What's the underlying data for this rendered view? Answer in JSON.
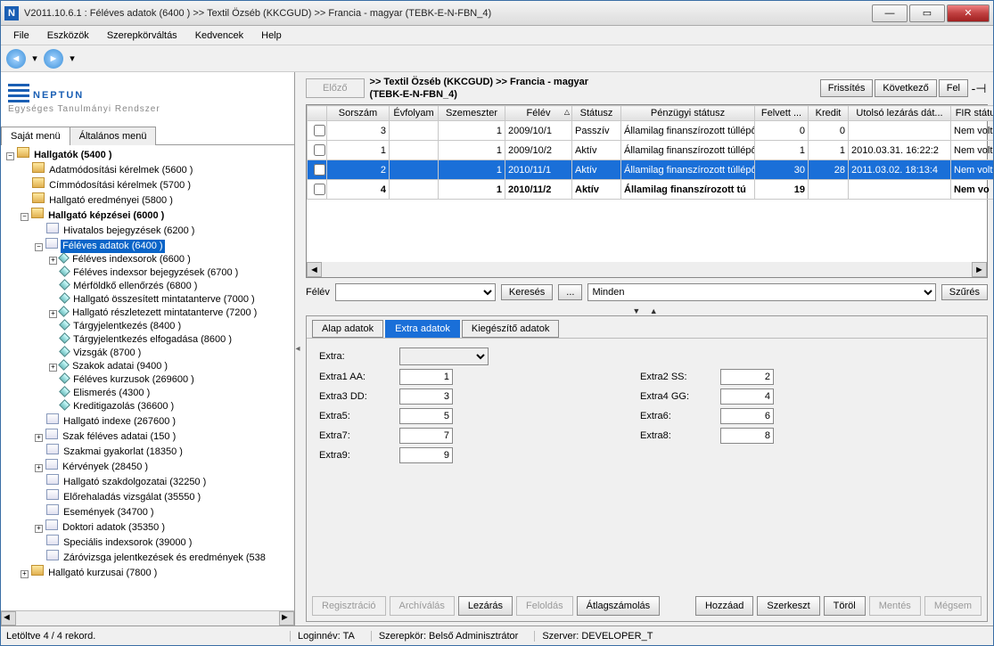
{
  "window": {
    "title": "V2011.10.6.1 : Féléves adatok (6400 )  >> Textil Özséb (KKCGUD) >> Francia - magyar  (TEBK-E-N-FBN_4)",
    "icon_letter": "N"
  },
  "menubar": [
    "File",
    "Eszközök",
    "Szerepkörváltás",
    "Kedvencek",
    "Help"
  ],
  "logo": {
    "name": "NEPTUN",
    "sub": "Egységes Tanulmányi Rendszer"
  },
  "tree_tabs": {
    "active": "Saját menü",
    "inactive": "Általános menü"
  },
  "tree": [
    {
      "d": 0,
      "t": "minus",
      "i": "folder",
      "bold": true,
      "label": "Hallgatók (5400  )"
    },
    {
      "d": 1,
      "t": "none",
      "i": "folder",
      "label": "Adatmódosítási kérelmek (5600  )"
    },
    {
      "d": 1,
      "t": "none",
      "i": "folder",
      "label": "Címmódosítási kérelmek (5700  )"
    },
    {
      "d": 1,
      "t": "none",
      "i": "folder",
      "label": "Hallgató eredményei (5800  )"
    },
    {
      "d": 1,
      "t": "minus",
      "i": "folder",
      "bold": true,
      "label": "Hallgató képzései (6000  )"
    },
    {
      "d": 2,
      "t": "none",
      "i": "doc",
      "label": "Hivatalos bejegyzések (6200  )"
    },
    {
      "d": 2,
      "t": "minus",
      "i": "doc",
      "sel": true,
      "label": "Féléves adatok (6400  )"
    },
    {
      "d": 3,
      "t": "plus",
      "i": "diam",
      "label": "Féléves indexsorok (6600  )"
    },
    {
      "d": 3,
      "t": "none",
      "i": "diam",
      "label": "Féléves indexsor bejegyzések (6700  )"
    },
    {
      "d": 3,
      "t": "none",
      "i": "diam",
      "label": "Mérföldkő ellenőrzés (6800  )"
    },
    {
      "d": 3,
      "t": "none",
      "i": "diam",
      "label": "Hallgató összesített mintatanterve (7000  )"
    },
    {
      "d": 3,
      "t": "plus",
      "i": "diam",
      "label": "Hallgató részletezett mintatanterve (7200  )"
    },
    {
      "d": 3,
      "t": "none",
      "i": "diam",
      "label": "Tárgyjelentkezés (8400  )"
    },
    {
      "d": 3,
      "t": "none",
      "i": "diam",
      "label": "Tárgyjelentkezés elfogadása (8600  )"
    },
    {
      "d": 3,
      "t": "none",
      "i": "diam",
      "label": "Vizsgák (8700  )"
    },
    {
      "d": 3,
      "t": "plus",
      "i": "diam",
      "label": "Szakok adatai (9400  )"
    },
    {
      "d": 3,
      "t": "none",
      "i": "diam",
      "label": "Féléves kurzusok (269600  )"
    },
    {
      "d": 3,
      "t": "none",
      "i": "diam",
      "label": "Elismerés (4300  )"
    },
    {
      "d": 3,
      "t": "none",
      "i": "diam",
      "label": "Kreditigazolás (36600  )"
    },
    {
      "d": 2,
      "t": "none",
      "i": "doc",
      "label": "Hallgató indexe (267600  )"
    },
    {
      "d": 2,
      "t": "plus",
      "i": "doc",
      "label": "Szak féléves adatai (150  )"
    },
    {
      "d": 2,
      "t": "none",
      "i": "doc",
      "label": "Szakmai gyakorlat (18350  )"
    },
    {
      "d": 2,
      "t": "plus",
      "i": "doc",
      "label": "Kérvények (28450  )"
    },
    {
      "d": 2,
      "t": "none",
      "i": "doc",
      "label": "Hallgató szakdolgozatai (32250  )"
    },
    {
      "d": 2,
      "t": "none",
      "i": "doc",
      "label": "Előrehaladás vizsgálat (35550  )"
    },
    {
      "d": 2,
      "t": "none",
      "i": "doc",
      "label": "Események (34700  )"
    },
    {
      "d": 2,
      "t": "plus",
      "i": "doc",
      "label": "Doktori adatok (35350  )"
    },
    {
      "d": 2,
      "t": "none",
      "i": "doc",
      "label": "Speciális indexsorok (39000  )"
    },
    {
      "d": 2,
      "t": "none",
      "i": "doc",
      "label": "Záróvizsga jelentkezések és eredmények (538"
    },
    {
      "d": 1,
      "t": "plus",
      "i": "folder",
      "label": "Hallgató kurzusai (7800  )"
    }
  ],
  "right": {
    "prev_label": "Előző",
    "breadcrumb_l1": ">> Textil Özséb (KKCGUD) >> Francia - magyar",
    "breadcrumb_l2": "(TEBK-E-N-FBN_4)",
    "btn_refresh": "Frissítés",
    "btn_next": "Következő",
    "btn_up": "Fel",
    "pin": "-⊣"
  },
  "grid": {
    "headers": [
      "",
      "Sorszám",
      "Évfolyam",
      "Szemeszter",
      "Félév",
      "Státusz",
      "Pénzügyi státusz",
      "Felvett ...",
      "Kredit",
      "Utolsó lezárás dát...",
      "FIR státu"
    ],
    "widths": [
      22,
      70,
      55,
      75,
      75,
      55,
      150,
      60,
      45,
      115,
      55
    ],
    "sort_col": 4,
    "rows": [
      {
        "sel": false,
        "bold": false,
        "cells": [
          "",
          "3",
          "",
          "1",
          "2009/10/1",
          "Passzív",
          "Államilag finanszírozott túllépő (",
          "0",
          "0",
          "",
          "Nem volt"
        ]
      },
      {
        "sel": false,
        "bold": false,
        "cells": [
          "",
          "1",
          "",
          "1",
          "2009/10/2",
          "Aktív",
          "Államilag finanszírozott túllépő (",
          "1",
          "1",
          "2010.03.31. 16:22:2",
          "Nem volt"
        ]
      },
      {
        "sel": true,
        "bold": false,
        "cells": [
          "",
          "2",
          "",
          "1",
          "2010/11/1",
          "Aktív",
          "Államilag finanszírozott túllépő (",
          "30",
          "28",
          "2011.03.02. 18:13:4",
          "Nem volt"
        ]
      },
      {
        "sel": false,
        "bold": true,
        "cells": [
          "",
          "4",
          "",
          "1",
          "2010/11/2",
          "Aktív",
          "Államilag finanszírozott tú",
          "19",
          "",
          "",
          "Nem vo"
        ]
      }
    ]
  },
  "filter": {
    "felev_label": "Félév",
    "btn_kereses": "Keresés",
    "btn_dots": "...",
    "minden": "Minden",
    "btn_szures": "Szűrés"
  },
  "tabs": {
    "t1": "Alap adatok",
    "t2": "Extra adatok",
    "t3": "Kiegészítő adatok",
    "active": 2
  },
  "form": {
    "extra_label": "Extra:",
    "rows": [
      {
        "l1": "Extra1 AA:",
        "v1": "1",
        "l2": "Extra2 SS:",
        "v2": "2"
      },
      {
        "l1": "Extra3 DD:",
        "v1": "3",
        "l2": "Extra4 GG:",
        "v2": "4"
      },
      {
        "l1": "Extra5:",
        "v1": "5",
        "l2": "Extra6:",
        "v2": "6"
      },
      {
        "l1": "Extra7:",
        "v1": "7",
        "l2": "Extra8:",
        "v2": "8"
      },
      {
        "l1": "Extra9:",
        "v1": "9",
        "l2": "",
        "v2": ""
      }
    ]
  },
  "actions": {
    "regisztracio": "Regisztráció",
    "archivalas": "Archíválás",
    "lezaras": "Lezárás",
    "feloldas": "Feloldás",
    "atlag": "Átlagszámolás",
    "hozzaad": "Hozzáad",
    "szerkeszt": "Szerkeszt",
    "torol": "Töröl",
    "mentes": "Mentés",
    "megsem": "Mégsem"
  },
  "status": {
    "left": "Letöltve 4 / 4 rekord.",
    "login": "Loginnév: TA",
    "role": "Szerepkör: Belső Adminisztrátor",
    "server": "Szerver: DEVELOPER_T"
  }
}
